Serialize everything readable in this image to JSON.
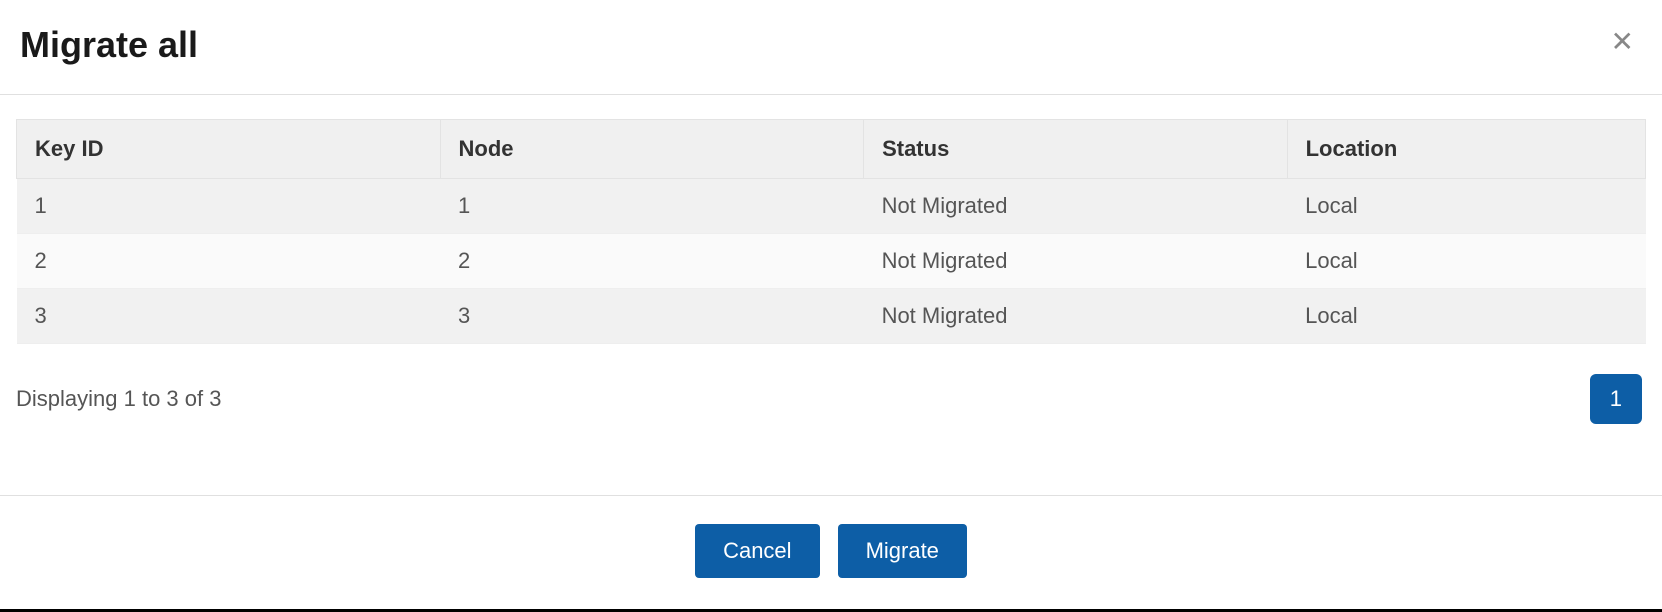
{
  "dialog": {
    "title": "Migrate all"
  },
  "table": {
    "headers": {
      "key_id": "Key ID",
      "node": "Node",
      "status": "Status",
      "location": "Location"
    },
    "rows": [
      {
        "key_id": "1",
        "node": "1",
        "status": "Not Migrated",
        "location": "Local"
      },
      {
        "key_id": "2",
        "node": "2",
        "status": "Not Migrated",
        "location": "Local"
      },
      {
        "key_id": "3",
        "node": "3",
        "status": "Not Migrated",
        "location": "Local"
      }
    ]
  },
  "pager": {
    "display_text": "Displaying 1 to 3 of 3",
    "current_page": "1"
  },
  "buttons": {
    "cancel": "Cancel",
    "migrate": "Migrate"
  }
}
